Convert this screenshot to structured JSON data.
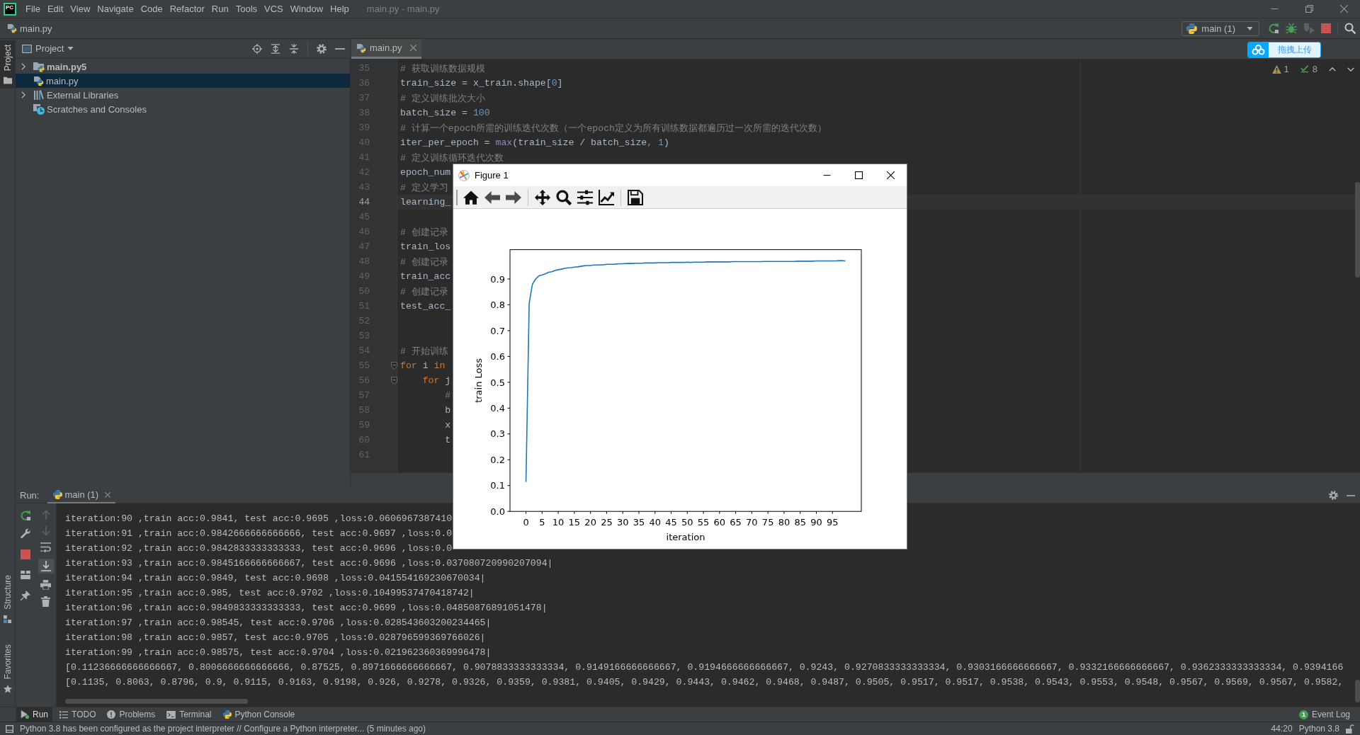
{
  "menu_bar": {
    "logo": "PC",
    "items": [
      "File",
      "Edit",
      "View",
      "Navigate",
      "Code",
      "Refactor",
      "Run",
      "Tools",
      "VCS",
      "Window",
      "Help"
    ],
    "title": "main.py - main.py"
  },
  "nav_bar": {
    "breadcrumb": "main.py",
    "run_config": "main (1)"
  },
  "upload_widget": {
    "label": "拖拽上传"
  },
  "tool_strip": {
    "top": [
      {
        "label": "Project",
        "kind": "project",
        "selected": true
      }
    ],
    "bottom": [
      {
        "label": "Structure",
        "kind": "structure",
        "selected": false
      },
      {
        "label": "Favorites",
        "kind": "favorites",
        "selected": false
      }
    ]
  },
  "project_panel": {
    "title": "Project",
    "items": [
      {
        "label": "main.py5",
        "kind": "project",
        "expanded": false,
        "selected": false
      },
      {
        "label": "main.py",
        "kind": "file",
        "selected": true
      },
      {
        "label": "External Libraries",
        "kind": "libraries",
        "expanded": false,
        "selected": false
      },
      {
        "label": "Scratches and Consoles",
        "kind": "scratches",
        "selected": false
      }
    ]
  },
  "editor": {
    "tabs": [
      {
        "label": "main.py",
        "selected": true
      }
    ],
    "warnings": "1",
    "weak_warnings": "8",
    "lines": [
      {
        "number": "35",
        "current": false,
        "fold": false,
        "tokens": [
          {
            "kind": "comment",
            "text": "# 获取训练数据规模"
          }
        ]
      },
      {
        "number": "36",
        "current": false,
        "fold": false,
        "tokens": [
          {
            "kind": "plain",
            "text": "train_size = x_train.shape["
          },
          {
            "kind": "number",
            "text": "0"
          },
          {
            "kind": "plain",
            "text": "]"
          }
        ]
      },
      {
        "number": "37",
        "current": false,
        "fold": false,
        "tokens": [
          {
            "kind": "comment",
            "text": "# 定义训练批次大小"
          }
        ]
      },
      {
        "number": "38",
        "current": false,
        "fold": false,
        "tokens": [
          {
            "kind": "plain",
            "text": "batch_size = "
          },
          {
            "kind": "number",
            "text": "100"
          }
        ]
      },
      {
        "number": "39",
        "current": false,
        "fold": false,
        "tokens": [
          {
            "kind": "comment",
            "text": "# 计算一个epoch所需的训练迭代次数（一个epoch定义为所有训练数据都遍历过一次所需的迭代次数）"
          }
        ]
      },
      {
        "number": "40",
        "current": false,
        "fold": false,
        "tokens": [
          {
            "kind": "plain",
            "text": "iter_per_epoch = "
          },
          {
            "kind": "builtin",
            "text": "max"
          },
          {
            "kind": "plain",
            "text": "(train_size / batch_size"
          },
          {
            "kind": "punct",
            "text": ", "
          },
          {
            "kind": "number",
            "text": "1"
          },
          {
            "kind": "plain",
            "text": ")"
          }
        ]
      },
      {
        "number": "41",
        "current": false,
        "fold": false,
        "tokens": [
          {
            "kind": "comment",
            "text": "# 定义训练循环迭代次数"
          }
        ]
      },
      {
        "number": "42",
        "current": false,
        "fold": false,
        "tokens": [
          {
            "kind": "plain",
            "text": "epoch_num"
          }
        ]
      },
      {
        "number": "43",
        "current": false,
        "fold": false,
        "tokens": [
          {
            "kind": "comment",
            "text": "# 定义学习"
          }
        ]
      },
      {
        "number": "44",
        "current": true,
        "fold": false,
        "tokens": [
          {
            "kind": "plain",
            "text": "learning_"
          }
        ]
      },
      {
        "number": "45",
        "current": false,
        "fold": false
      },
      {
        "number": "46",
        "current": false,
        "fold": false,
        "tokens": [
          {
            "kind": "comment",
            "text": "# 创建记录"
          }
        ]
      },
      {
        "number": "47",
        "current": false,
        "fold": false,
        "tokens": [
          {
            "kind": "plain",
            "text": "train_los"
          }
        ]
      },
      {
        "number": "48",
        "current": false,
        "fold": false,
        "tokens": [
          {
            "kind": "comment",
            "text": "# 创建记录"
          }
        ]
      },
      {
        "number": "49",
        "current": false,
        "fold": false,
        "tokens": [
          {
            "kind": "plain",
            "text": "train_acc"
          }
        ]
      },
      {
        "number": "50",
        "current": false,
        "fold": false,
        "tokens": [
          {
            "kind": "comment",
            "text": "# 创建记录"
          }
        ]
      },
      {
        "number": "51",
        "current": false,
        "fold": false,
        "tokens": [
          {
            "kind": "plain",
            "text": "test_acc_"
          }
        ]
      },
      {
        "number": "52",
        "current": false,
        "fold": false
      },
      {
        "number": "53",
        "current": false,
        "fold": false
      },
      {
        "number": "54",
        "current": false,
        "fold": false,
        "tokens": [
          {
            "kind": "comment",
            "text": "# 开始训练"
          }
        ]
      },
      {
        "number": "55",
        "current": false,
        "fold": true,
        "tokens": [
          {
            "kind": "keyword",
            "text": "for"
          },
          {
            "kind": "plain",
            "text": " i "
          },
          {
            "kind": "keyword",
            "text": "in"
          }
        ]
      },
      {
        "number": "56",
        "current": false,
        "fold": true,
        "tokens": [
          {
            "kind": "keyword",
            "text": "    for"
          },
          {
            "kind": "plain",
            "text": " j"
          }
        ]
      },
      {
        "number": "57",
        "current": false,
        "fold": false,
        "tokens": [
          {
            "kind": "comment",
            "text": "        #"
          }
        ]
      },
      {
        "number": "58",
        "current": false,
        "fold": false,
        "tokens": [
          {
            "kind": "plain",
            "text": "        b"
          }
        ]
      },
      {
        "number": "59",
        "current": false,
        "fold": false,
        "tokens": [
          {
            "kind": "plain",
            "text": "        x"
          }
        ]
      },
      {
        "number": "60",
        "current": false,
        "fold": false,
        "tokens": [
          {
            "kind": "plain",
            "text": "        t"
          }
        ]
      },
      {
        "number": "61",
        "current": false,
        "fold": false
      }
    ]
  },
  "run_panel": {
    "label": "Run:",
    "tabs": [
      {
        "label": "main (1)",
        "selected": true
      }
    ],
    "scroll_to_end": true,
    "lines": [
      "iteration:90 ,train acc:0.9841, test acc:0.9695 ,loss:0.0606967387410",
      "iteration:91 ,train acc:0.9842666666666666, test acc:0.9697 ,loss:0.0",
      "iteration:92 ,train acc:0.9842833333333333, test acc:0.9696 ,loss:0.0",
      "iteration:93 ,train acc:0.9845166666666667, test acc:0.9696 ,loss:0.037080720990207094|",
      "iteration:94 ,train acc:0.9849, test acc:0.9698 ,loss:0.041554169230670034|",
      "iteration:95 ,train acc:0.985, test acc:0.9702 ,loss:0.10499537470418742|",
      "iteration:96 ,train acc:0.9849833333333333, test acc:0.9699 ,loss:0.04850876891051478|",
      "iteration:97 ,train acc:0.98545, test acc:0.9706 ,loss:0.028543603200234465|",
      "iteration:98 ,train acc:0.9857, test acc:0.9705 ,loss:0.028796599369766026|",
      "iteration:99 ,train acc:0.98575, test acc:0.9704 ,loss:0.021962360369996478|",
      "[0.11236666666666667, 0.8006666666666666, 0.87525, 0.8971666666666667, 0.9078833333333334, 0.9149166666666667, 0.9194666666666667, 0.9243, 0.9270833333333334, 0.9303166666666667, 0.9332166666666667, 0.9362333333333334, 0.9394166",
      "[0.1135, 0.8063, 0.8796, 0.9, 0.9115, 0.9163, 0.9198, 0.926, 0.9278, 0.9326, 0.9359, 0.9381, 0.9405, 0.9429, 0.9443, 0.9462, 0.9468, 0.9487, 0.9505, 0.9517, 0.9517, 0.9538, 0.9543, 0.9553, 0.9548, 0.9567, 0.9569, 0.9567, 0.9582,"
    ]
  },
  "bottom_bar": {
    "tabs": [
      {
        "label": "Run",
        "kind": "run",
        "selected": true
      },
      {
        "label": "TODO",
        "kind": "todo",
        "selected": false
      },
      {
        "label": "Problems",
        "kind": "problems",
        "selected": false
      },
      {
        "label": "Terminal",
        "kind": "terminal",
        "selected": false
      },
      {
        "label": "Python Console",
        "kind": "python",
        "selected": false
      }
    ],
    "event_log": {
      "label": "Event Log",
      "count": "1"
    }
  },
  "status_bar": {
    "message": "Python 3.8 has been configured as the project interpreter // Configure a Python interpreter... (5 minutes ago)",
    "position": "44:20",
    "interpreter": "Python 3.8"
  },
  "figure_window": {
    "title": "Figure 1",
    "chart_data": {
      "type": "line",
      "xlabel": "iteration",
      "ylabel": "train Loss",
      "x": [
        0,
        1,
        2,
        3,
        4,
        5,
        6,
        7,
        8,
        9,
        10,
        11,
        12,
        13,
        14,
        15,
        16,
        17,
        18,
        19,
        20,
        21,
        22,
        23,
        24,
        25,
        26,
        27,
        28,
        29,
        30,
        31,
        32,
        33,
        34,
        35,
        36,
        37,
        38,
        39,
        40,
        41,
        42,
        43,
        44,
        45,
        46,
        47,
        48,
        49,
        50,
        51,
        52,
        53,
        54,
        55,
        56,
        57,
        58,
        59,
        60,
        61,
        62,
        63,
        64,
        65,
        66,
        67,
        68,
        69,
        70,
        71,
        72,
        73,
        74,
        75,
        76,
        77,
        78,
        79,
        80,
        81,
        82,
        83,
        84,
        85,
        86,
        87,
        88,
        89,
        90,
        91,
        92,
        93,
        94,
        95,
        96,
        97,
        98,
        99
      ],
      "series": [
        {
          "color": "#1f77b4",
          "values": [
            0.114,
            0.806,
            0.88,
            0.9,
            0.912,
            0.916,
            0.92,
            0.926,
            0.928,
            0.933,
            0.936,
            0.938,
            0.941,
            0.943,
            0.944,
            0.946,
            0.947,
            0.949,
            0.951,
            0.952,
            0.952,
            0.954,
            0.954,
            0.955,
            0.955,
            0.957,
            0.957,
            0.957,
            0.958,
            0.959,
            0.959,
            0.96,
            0.96,
            0.96,
            0.961,
            0.961,
            0.961,
            0.962,
            0.962,
            0.962,
            0.962,
            0.963,
            0.963,
            0.963,
            0.963,
            0.964,
            0.964,
            0.964,
            0.964,
            0.964,
            0.965,
            0.964,
            0.965,
            0.965,
            0.965,
            0.965,
            0.966,
            0.966,
            0.966,
            0.966,
            0.966,
            0.966,
            0.966,
            0.966,
            0.967,
            0.967,
            0.967,
            0.967,
            0.967,
            0.967,
            0.967,
            0.967,
            0.967,
            0.967,
            0.968,
            0.968,
            0.968,
            0.968,
            0.968,
            0.968,
            0.968,
            0.968,
            0.968,
            0.968,
            0.969,
            0.969,
            0.969,
            0.969,
            0.969,
            0.969,
            0.97,
            0.97,
            0.97,
            0.97,
            0.97,
            0.97,
            0.97,
            0.971,
            0.971,
            0.97
          ]
        }
      ],
      "xlim": [
        -4.95,
        103.95
      ],
      "ylim": [
        0,
        1.0135
      ],
      "xticks": [
        0,
        5,
        10,
        15,
        20,
        25,
        30,
        35,
        40,
        45,
        50,
        55,
        60,
        65,
        70,
        75,
        80,
        85,
        90,
        95
      ],
      "yticks": [
        {
          "value": 0,
          "label": "0.0"
        },
        0.1,
        0.2,
        0.3,
        0.4,
        0.5,
        0.6,
        0.7,
        0.8,
        0.9
      ]
    }
  }
}
